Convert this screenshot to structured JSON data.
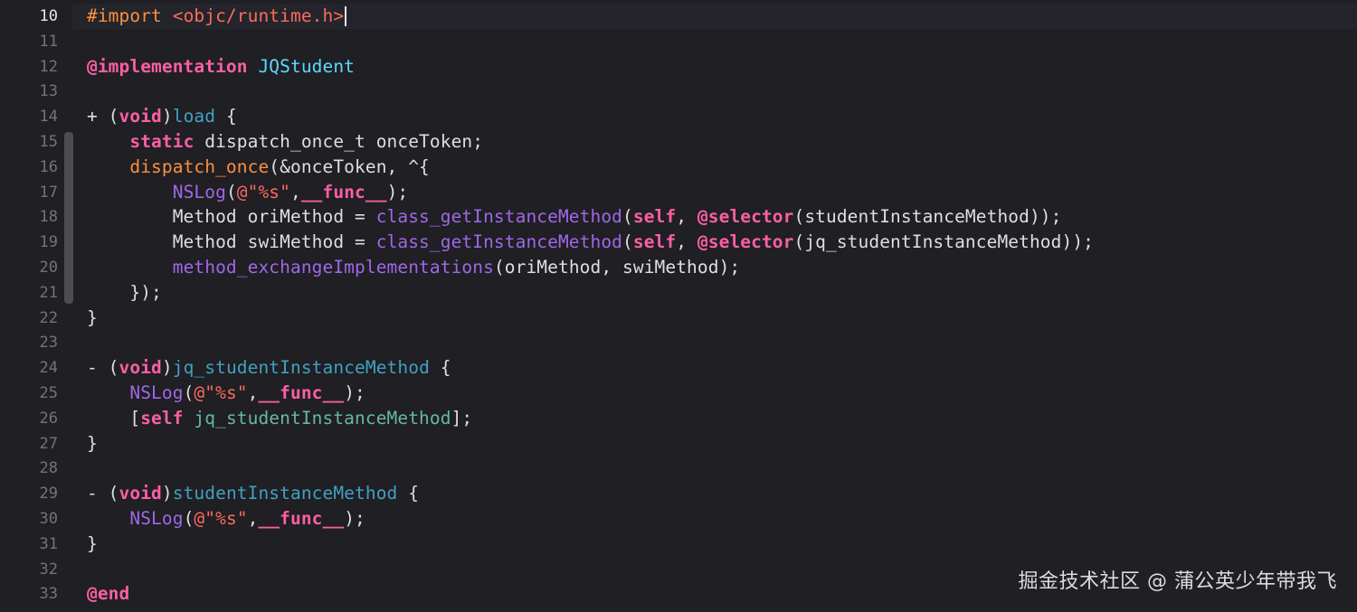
{
  "editor": {
    "current_line_number": 10,
    "theme_colors": {
      "background": "#1f1f24",
      "text": "#dfdfe0",
      "keyword": "#fc5fa3",
      "preprocessor": "#fd8f3f",
      "string": "#fc6a5d",
      "function_call": "#a167e6",
      "function_decl": "#41a1c0",
      "class_name": "#5dd8ff",
      "project_method": "#67b7a4",
      "line_number": "#747478"
    },
    "lines": [
      {
        "n": "10",
        "tokens": [
          {
            "t": "#import ",
            "c": "pre"
          },
          {
            "t": "<objc/runtime.h>",
            "c": "str"
          }
        ],
        "cursor": true
      },
      {
        "n": "11",
        "tokens": []
      },
      {
        "n": "12",
        "tokens": [
          {
            "t": "@implementation",
            "c": "kw"
          },
          {
            "t": " ",
            "c": "plain"
          },
          {
            "t": "JQStudent",
            "c": "cls"
          }
        ]
      },
      {
        "n": "13",
        "tokens": []
      },
      {
        "n": "14",
        "tokens": [
          {
            "t": "+ (",
            "c": "plain"
          },
          {
            "t": "void",
            "c": "kw"
          },
          {
            "t": ")",
            "c": "plain"
          },
          {
            "t": "load",
            "c": "decl"
          },
          {
            "t": " {",
            "c": "plain"
          }
        ]
      },
      {
        "n": "15",
        "tokens": [
          {
            "t": "    ",
            "c": "plain"
          },
          {
            "t": "static",
            "c": "kw"
          },
          {
            "t": " dispatch_once_t onceToken;",
            "c": "plain"
          }
        ]
      },
      {
        "n": "16",
        "tokens": [
          {
            "t": "    ",
            "c": "plain"
          },
          {
            "t": "dispatch_once",
            "c": "pre"
          },
          {
            "t": "(&onceToken, ^{",
            "c": "plain"
          }
        ]
      },
      {
        "n": "17",
        "tokens": [
          {
            "t": "        ",
            "c": "plain"
          },
          {
            "t": "NSLog",
            "c": "fn"
          },
          {
            "t": "(",
            "c": "plain"
          },
          {
            "t": "@\"%s\"",
            "c": "str"
          },
          {
            "t": ",",
            "c": "plain"
          },
          {
            "t": "__func__",
            "c": "kw"
          },
          {
            "t": ");",
            "c": "plain"
          }
        ]
      },
      {
        "n": "18",
        "tokens": [
          {
            "t": "        Method oriMethod = ",
            "c": "plain"
          },
          {
            "t": "class_getInstanceMethod",
            "c": "fn"
          },
          {
            "t": "(",
            "c": "plain"
          },
          {
            "t": "self",
            "c": "kw"
          },
          {
            "t": ", ",
            "c": "plain"
          },
          {
            "t": "@selector",
            "c": "kw"
          },
          {
            "t": "(studentInstanceMethod));",
            "c": "plain"
          }
        ]
      },
      {
        "n": "19",
        "tokens": [
          {
            "t": "        Method swiMethod = ",
            "c": "plain"
          },
          {
            "t": "class_getInstanceMethod",
            "c": "fn"
          },
          {
            "t": "(",
            "c": "plain"
          },
          {
            "t": "self",
            "c": "kw"
          },
          {
            "t": ", ",
            "c": "plain"
          },
          {
            "t": "@selector",
            "c": "kw"
          },
          {
            "t": "(jq_studentInstanceMethod));",
            "c": "plain"
          }
        ]
      },
      {
        "n": "20",
        "tokens": [
          {
            "t": "        ",
            "c": "plain"
          },
          {
            "t": "method_exchangeImplementations",
            "c": "fn"
          },
          {
            "t": "(oriMethod, swiMethod);",
            "c": "plain"
          }
        ]
      },
      {
        "n": "21",
        "tokens": [
          {
            "t": "    });",
            "c": "plain"
          }
        ]
      },
      {
        "n": "22",
        "tokens": [
          {
            "t": "}",
            "c": "plain"
          }
        ]
      },
      {
        "n": "23",
        "tokens": []
      },
      {
        "n": "24",
        "tokens": [
          {
            "t": "- (",
            "c": "plain"
          },
          {
            "t": "void",
            "c": "kw"
          },
          {
            "t": ")",
            "c": "plain"
          },
          {
            "t": "jq_studentInstanceMethod",
            "c": "decl"
          },
          {
            "t": " {",
            "c": "plain"
          }
        ]
      },
      {
        "n": "25",
        "tokens": [
          {
            "t": "    ",
            "c": "plain"
          },
          {
            "t": "NSLog",
            "c": "fn"
          },
          {
            "t": "(",
            "c": "plain"
          },
          {
            "t": "@\"%s\"",
            "c": "str"
          },
          {
            "t": ",",
            "c": "plain"
          },
          {
            "t": "__func__",
            "c": "kw"
          },
          {
            "t": ");",
            "c": "plain"
          }
        ]
      },
      {
        "n": "26",
        "tokens": [
          {
            "t": "    [",
            "c": "plain"
          },
          {
            "t": "self",
            "c": "kw"
          },
          {
            "t": " ",
            "c": "plain"
          },
          {
            "t": "jq_studentInstanceMethod",
            "c": "proj"
          },
          {
            "t": "];",
            "c": "plain"
          }
        ]
      },
      {
        "n": "27",
        "tokens": [
          {
            "t": "}",
            "c": "plain"
          }
        ]
      },
      {
        "n": "28",
        "tokens": []
      },
      {
        "n": "29",
        "tokens": [
          {
            "t": "- (",
            "c": "plain"
          },
          {
            "t": "void",
            "c": "kw"
          },
          {
            "t": ")",
            "c": "plain"
          },
          {
            "t": "studentInstanceMethod",
            "c": "decl"
          },
          {
            "t": " {",
            "c": "plain"
          }
        ]
      },
      {
        "n": "30",
        "tokens": [
          {
            "t": "    ",
            "c": "plain"
          },
          {
            "t": "NSLog",
            "c": "fn"
          },
          {
            "t": "(",
            "c": "plain"
          },
          {
            "t": "@\"%s\"",
            "c": "str"
          },
          {
            "t": ",",
            "c": "plain"
          },
          {
            "t": "__func__",
            "c": "kw"
          },
          {
            "t": ");",
            "c": "plain"
          }
        ]
      },
      {
        "n": "31",
        "tokens": [
          {
            "t": "}",
            "c": "plain"
          }
        ]
      },
      {
        "n": "32",
        "tokens": []
      },
      {
        "n": "33",
        "tokens": [
          {
            "t": "@end",
            "c": "kw"
          }
        ]
      }
    ]
  },
  "watermark": {
    "text": "掘金技术社区 @ 蒲公英少年带我飞"
  }
}
